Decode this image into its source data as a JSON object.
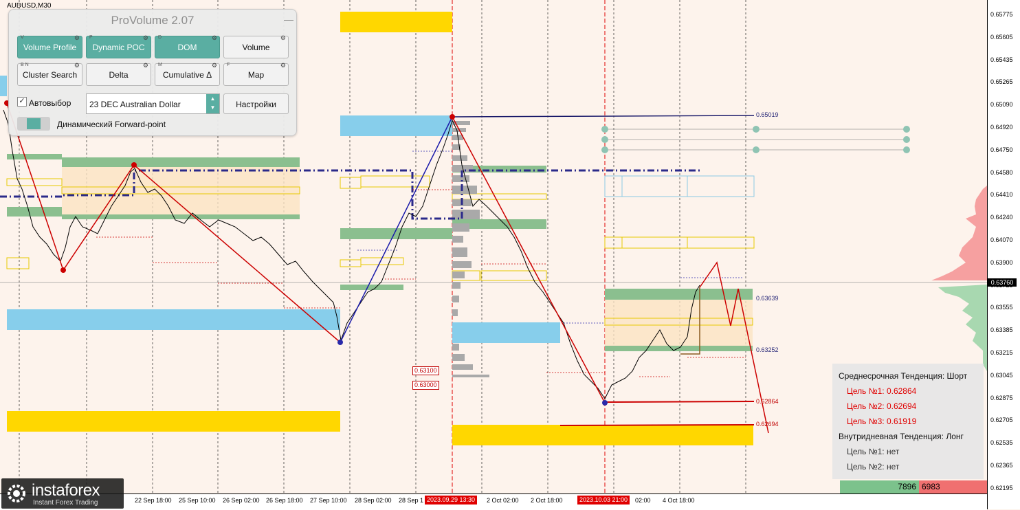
{
  "symbol": "AUDUSD,M30",
  "price_axis": {
    "ticks": [
      "0.65775",
      "0.65605",
      "0.65435",
      "0.65265",
      "0.65090",
      "0.64920",
      "0.64750",
      "0.64580",
      "0.64410",
      "0.64240",
      "0.64070",
      "0.63900",
      "0.63725",
      "0.63555",
      "0.63385",
      "0.63215",
      "0.63045",
      "0.62875",
      "0.62705",
      "0.62535",
      "0.62365",
      "0.62195"
    ],
    "current_price": "0.63760"
  },
  "time_axis": {
    "labels": [
      "22 Sep 18:00",
      "25 Sep 10:00",
      "26 Sep 02:00",
      "26 Sep 18:00",
      "27 Sep 10:00",
      "28 Sep 02:00",
      "28 Sep 1",
      "2 Oct 02:00",
      "2 Oct 18:00",
      "02:00",
      "4 Oct 18:00"
    ],
    "highlight_tags": [
      "2023.09.29 13:30",
      "2023.10.03 21:00"
    ]
  },
  "levels": {
    "upper": "0.65019",
    "upper_zone_top": "0.63639",
    "upper_zone_bottom": "0.63252",
    "target1": "0.62864",
    "target2": "0.62694",
    "boxed_a": "0.63100",
    "boxed_b": "0.63000"
  },
  "panel": {
    "title": "ProVolume 2.07",
    "minimize": "—",
    "buttons": [
      {
        "key": "V",
        "label": "Volume Profile",
        "active": true
      },
      {
        "key": "P",
        "label": "Dynamic POC",
        "active": true
      },
      {
        "key": "D",
        "label": "DOM",
        "active": true
      },
      {
        "key": "",
        "label": "Volume",
        "active": false
      },
      {
        "key": "B  N",
        "label": "Cluster Search",
        "active": false
      },
      {
        "key": "",
        "label": "Delta",
        "active": false
      },
      {
        "key": "M",
        "label": "Cumulative Δ",
        "active": false
      },
      {
        "key": "F",
        "label": "Map",
        "active": false
      }
    ],
    "gear": "⚙",
    "autoselect_label": "Автовыбор",
    "autoselect_checked": "✓",
    "instrument": "23 DEC Australian Dollar",
    "settings_label": "Настройки",
    "forward_point_label": "Динамический Forward-point"
  },
  "info_box": {
    "mid_trend": "Среднесрочная Тенденция: Шорт",
    "mid_targets": [
      "Цель №1: 0.62864",
      "Цель №2: 0.62694",
      "Цель №3: 0.61919"
    ],
    "intra_trend": "Внутридневная Тенденция: Лонг",
    "intra_targets": [
      "Цель №1: нет",
      "Цель №2: нет"
    ]
  },
  "volume_bar": {
    "buy": "7896",
    "sell": "6983"
  },
  "logo": {
    "name": "instaforex",
    "tagline": "Instant Forex Trading"
  },
  "colors": {
    "bull_zone": "#8bbf8f",
    "supply": "#ffd700",
    "demand": "#87ceeb",
    "trend_down": "#cc0000",
    "trend_up": "#1a1aaa",
    "poc": "#2a2a8a"
  }
}
